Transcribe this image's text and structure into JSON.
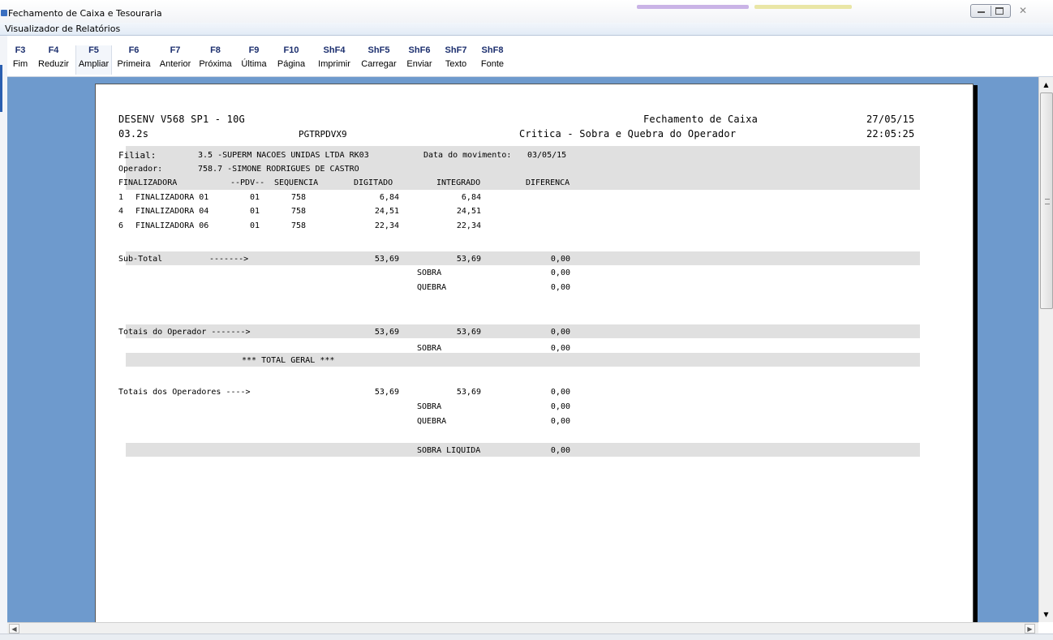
{
  "window": {
    "title": "Fechamento de Caixa e Tesouraria",
    "child_title": "Visualizador de Relatórios"
  },
  "toolbar": {
    "buttons": [
      {
        "key": "F3",
        "label": "Fim"
      },
      {
        "key": "F4",
        "label": "Reduzir"
      },
      {
        "key": "F5",
        "label": "Ampliar"
      },
      {
        "key": "F6",
        "label": "Primeira"
      },
      {
        "key": "F7",
        "label": "Anterior"
      },
      {
        "key": "F8",
        "label": "Próxima"
      },
      {
        "key": "F9",
        "label": "Última"
      },
      {
        "key": "F10",
        "label": "Página"
      },
      {
        "key": "ShF4",
        "label": "Imprimir"
      },
      {
        "key": "ShF5",
        "label": "Carregar"
      },
      {
        "key": "ShF6",
        "label": "Enviar"
      },
      {
        "key": "ShF7",
        "label": "Texto"
      },
      {
        "key": "ShF8",
        "label": "Fonte"
      }
    ]
  },
  "report": {
    "system": "DESENV V568 SP1 - 10G",
    "title": "Fechamento de Caixa",
    "date": "27/05/15",
    "version": "03.2s",
    "program": "PGTRPDVX9",
    "subtitle": "Critica - Sobra e Quebra do Operador",
    "time": "22:05:25",
    "filial_label": "Filial:",
    "filial_value": "3.5 -SUPERM NACOES UNIDAS LTDA RK03",
    "movimento_label": "Data do movimento:",
    "movimento_value": "03/05/15",
    "operador_label": "Operador:",
    "operador_value": "758.7 -SIMONE RODRIGUES DE CASTRO",
    "columns": {
      "finalizadora": "FINALIZADORA",
      "pdv": "--PDV--",
      "sequencia": "SEQUENCIA",
      "digitado": "DIGITADO",
      "integrado": "INTEGRADO",
      "diferenca": "DIFERENCA"
    },
    "rows": [
      {
        "code": "1",
        "name": "FINALIZADORA 01",
        "pdv": "01",
        "seq": "758",
        "digitado": "6,84",
        "integrado": "6,84"
      },
      {
        "code": "4",
        "name": "FINALIZADORA 04",
        "pdv": "01",
        "seq": "758",
        "digitado": "24,51",
        "integrado": "24,51"
      },
      {
        "code": "6",
        "name": "FINALIZADORA 06",
        "pdv": "01",
        "seq": "758",
        "digitado": "22,34",
        "integrado": "22,34"
      }
    ],
    "subtotal": {
      "label": "Sub-Total",
      "arrow": "------->",
      "digitado": "53,69",
      "integrado": "53,69",
      "diferenca": "0,00"
    },
    "subtotal_sobra": {
      "label": "SOBRA",
      "value": "0,00"
    },
    "subtotal_quebra": {
      "label": "QUEBRA",
      "value": "0,00"
    },
    "totais_operador": {
      "label": "Totais do Operador ------->",
      "digitado": "53,69",
      "integrado": "53,69",
      "diferenca": "0,00"
    },
    "totais_operador_sobra": {
      "label": "SOBRA",
      "value": "0,00"
    },
    "total_geral": "*** TOTAL GERAL ***",
    "totais_operadores": {
      "label": "Totais dos Operadores ---->",
      "digitado": "53,69",
      "integrado": "53,69",
      "diferenca": "0,00"
    },
    "totais_operadores_sobra": {
      "label": "SOBRA",
      "value": "0,00"
    },
    "totais_operadores_quebra": {
      "label": "QUEBRA",
      "value": "0,00"
    },
    "sobra_liquida": {
      "label": "SOBRA LIQUIDA",
      "value": "0,00"
    }
  }
}
